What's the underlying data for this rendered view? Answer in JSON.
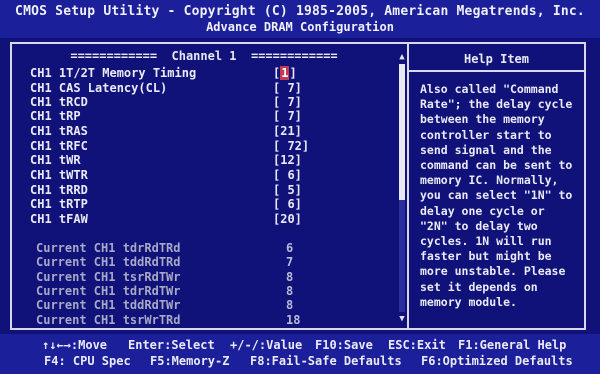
{
  "title": {
    "line1": "CMOS Setup Utility - Copyright (C) 1985-2005, American Megatrends, Inc.",
    "line2": "Advance DRAM Configuration"
  },
  "channel_header": "============  Channel 1  ============",
  "settings": [
    {
      "label": "CH1 1T/2T Memory Timing",
      "value_open": "[",
      "value": "1",
      "value_close": "]"
    },
    {
      "label": "CH1 CAS Latency(CL)",
      "value": "[ 7]"
    },
    {
      "label": "CH1 tRCD",
      "value": "[ 7]"
    },
    {
      "label": "CH1 tRP",
      "value": "[ 7]"
    },
    {
      "label": "CH1 tRAS",
      "value": "[21]"
    },
    {
      "label": "CH1 tRFC",
      "value": "[ 72]"
    },
    {
      "label": "CH1 tWR",
      "value": "[12]"
    },
    {
      "label": "CH1 tWTR",
      "value": "[ 6]"
    },
    {
      "label": "CH1 tRRD",
      "value": "[ 5]"
    },
    {
      "label": "CH1 tRTP",
      "value": "[ 6]"
    },
    {
      "label": "CH1 tFAW",
      "value": "[20]"
    }
  ],
  "current": [
    {
      "label": "Current CH1 tdrRdTRd",
      "value": "6"
    },
    {
      "label": "Current CH1 tddRdTRd",
      "value": "7"
    },
    {
      "label": "Current CH1 tsrRdTWr",
      "value": "8"
    },
    {
      "label": "Current CH1 tdrRdTWr",
      "value": "8"
    },
    {
      "label": "Current CH1 tddRdTWr",
      "value": "8"
    },
    {
      "label": "Current CH1 tsrWrTRd",
      "value": "18"
    }
  ],
  "help": {
    "title": "Help Item",
    "lines": [
      "Also called \"Command",
      "Rate\"; the delay cycle",
      "between the memory",
      "controller start to",
      "send signal and the",
      "command can be sent to",
      "memory IC. Normally,",
      "you can select \"1N\" to",
      "delay one cycle or",
      "\"2N\" to delay two",
      "cycles. 1N will run",
      "faster but might be",
      "more unstable. Please",
      "set it depends on",
      "memory module."
    ]
  },
  "footer": {
    "row1": [
      "↑↓←→:Move",
      "Enter:Select",
      "+/-/:Value",
      "F10:Save",
      "ESC:Exit",
      "F1:General Help"
    ],
    "row2": [
      "F4: CPU Spec",
      "F5:Memory-Z",
      "F8:Fail-Safe Defaults",
      "F6:Optimized Defaults"
    ]
  },
  "colors": {
    "background": "#10127a",
    "highlight": "#c33a55",
    "text": "#eaeaf6",
    "dim_text": "#a7a9c6"
  },
  "icons": {
    "scroll_up": "scroll-up-arrow-icon",
    "scroll_down": "scroll-down-arrow-icon"
  },
  "scroll_position_fraction": 0.55
}
